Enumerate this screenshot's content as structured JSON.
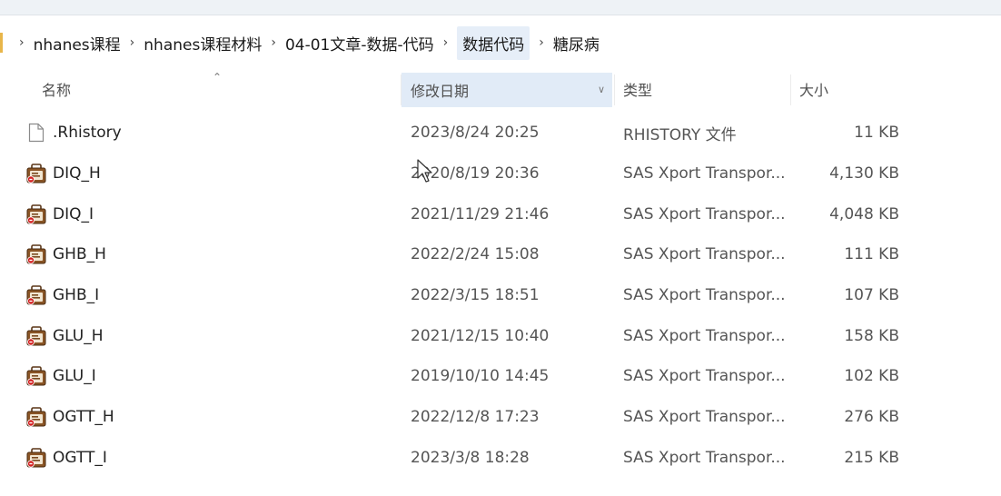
{
  "breadcrumb": {
    "items": [
      "nhanes课程",
      "nhanes课程材料",
      "04-01文章-数据-代码",
      "数据代码",
      "糖尿病"
    ]
  },
  "columns": {
    "name": "名称",
    "date": "修改日期",
    "type": "类型",
    "size": "大小"
  },
  "files": [
    {
      "icon": "document-icon",
      "name": ".Rhistory",
      "date": "2023/8/24 20:25",
      "type": "RHISTORY 文件",
      "size": "11 KB"
    },
    {
      "icon": "sas-file-icon",
      "name": "DIQ_H",
      "date": "2020/8/19 20:36",
      "type": "SAS Xport Transpor...",
      "size": "4,130 KB"
    },
    {
      "icon": "sas-file-icon",
      "name": "DIQ_I",
      "date": "2021/11/29 21:46",
      "type": "SAS Xport Transpor...",
      "size": "4,048 KB"
    },
    {
      "icon": "sas-file-icon",
      "name": "GHB_H",
      "date": "2022/2/24 15:08",
      "type": "SAS Xport Transpor...",
      "size": "111 KB"
    },
    {
      "icon": "sas-file-icon",
      "name": "GHB_I",
      "date": "2022/3/15 18:51",
      "type": "SAS Xport Transpor...",
      "size": "107 KB"
    },
    {
      "icon": "sas-file-icon",
      "name": "GLU_H",
      "date": "2021/12/15 10:40",
      "type": "SAS Xport Transpor...",
      "size": "158 KB"
    },
    {
      "icon": "sas-file-icon",
      "name": "GLU_I",
      "date": "2019/10/10 14:45",
      "type": "SAS Xport Transpor...",
      "size": "102 KB"
    },
    {
      "icon": "sas-file-icon",
      "name": "OGTT_H",
      "date": "2022/12/8 17:23",
      "type": "SAS Xport Transpor...",
      "size": "276 KB"
    },
    {
      "icon": "sas-file-icon",
      "name": "OGTT_I",
      "date": "2023/3/8 18:28",
      "type": "SAS Xport Transpor...",
      "size": "215 KB"
    }
  ]
}
